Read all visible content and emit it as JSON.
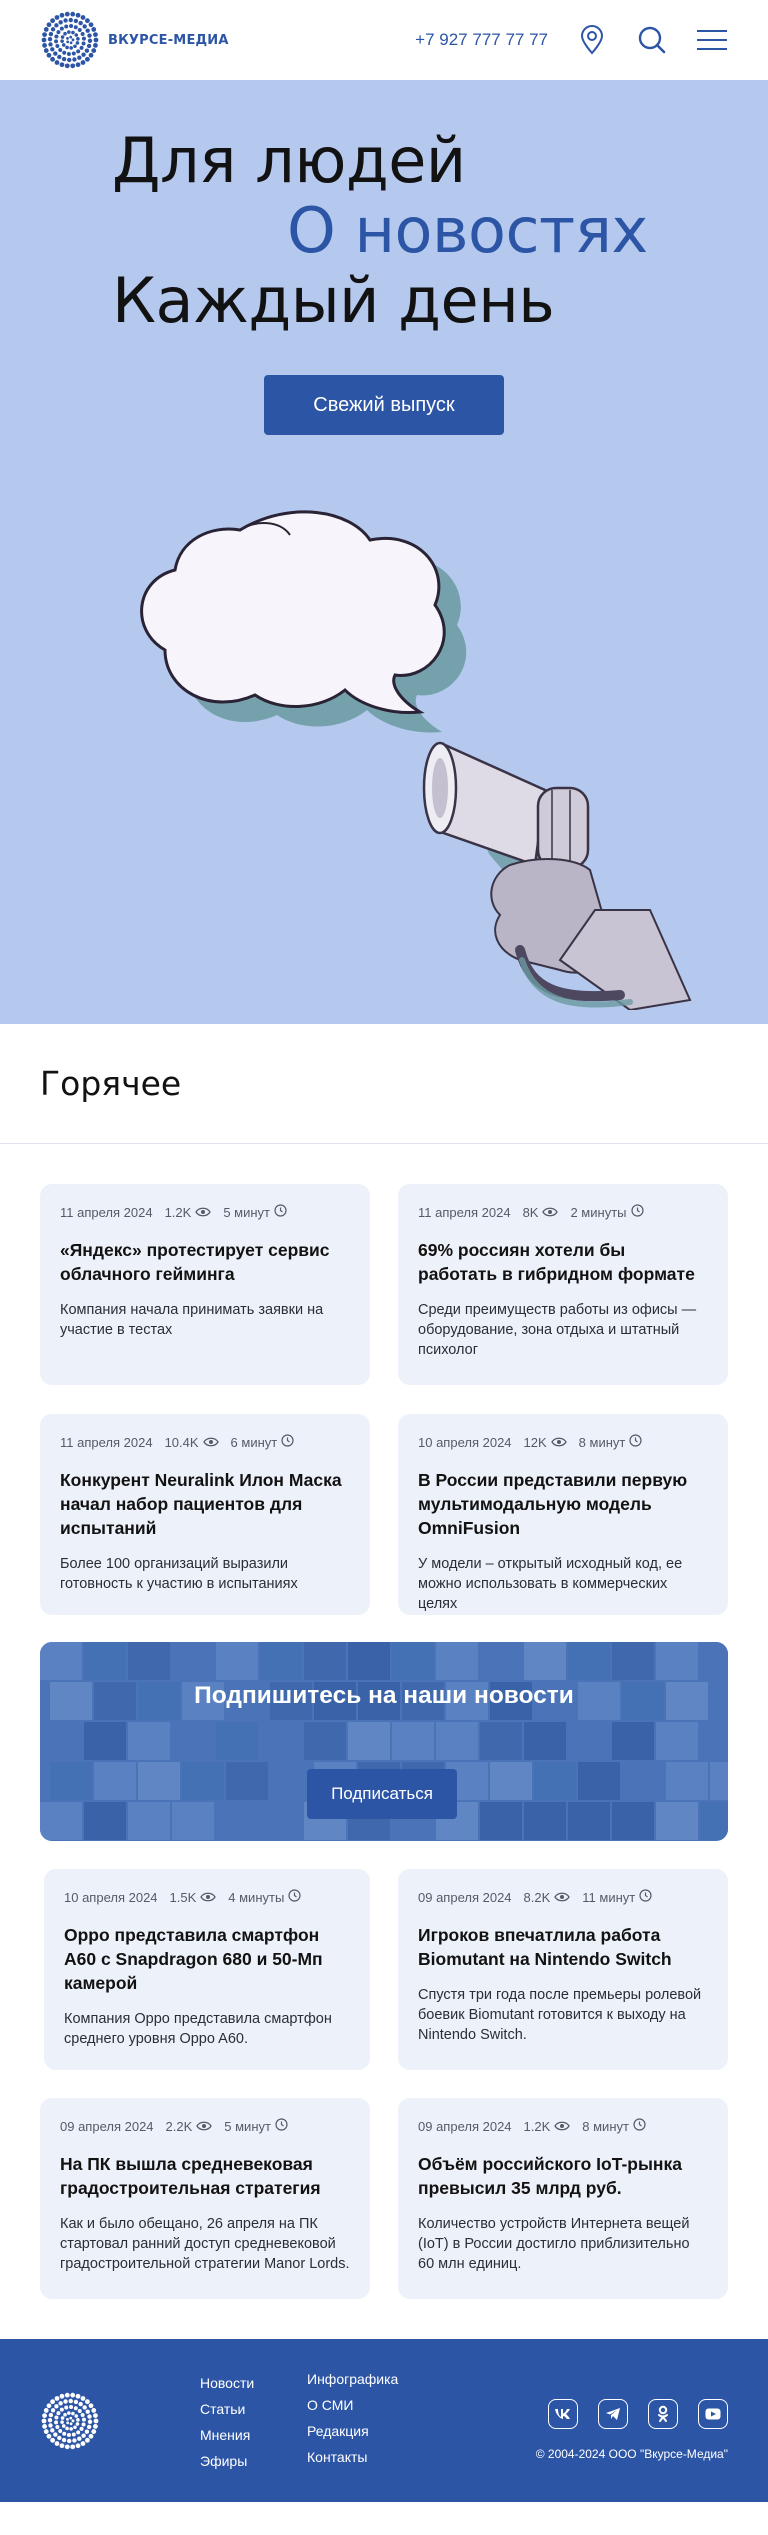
{
  "header": {
    "logo_text": "ВКУРСЕ-МЕДИА",
    "phone": "+7 927 777 77 77",
    "icons": [
      "location-pin-icon",
      "search-icon",
      "menu-icon"
    ]
  },
  "hero": {
    "line1": "Для людей",
    "line2": "О новостях",
    "line3": "Каждый день",
    "button": "Свежий выпуск"
  },
  "hot": {
    "title": "Горячее"
  },
  "cards_top": [
    {
      "date": "11 апреля 2024",
      "views": "1.2K",
      "read": "5 минут",
      "title": "«Яндекс» протестирует сервис облачного гейминга",
      "text": "Компания начала принимать заявки на участие в тестах"
    },
    {
      "date": "11 апреля 2024",
      "views": "8K",
      "read": "2 минуты",
      "title": "69% россиян хотели бы работать в гибридном формате",
      "text": "Среди преимуществ работы из офисы — оборудование, зона отдыха и штатный психолог"
    },
    {
      "date": "11 апреля 2024",
      "views": "10.4K",
      "read": "6 минут",
      "title": "Конкурент Neuralink Илон Маска начал набор пациентов для испытаний",
      "text": "Более 100 организаций выразили готовность к участию в испытаниях"
    },
    {
      "date": "10 апреля 2024",
      "views": "12K",
      "read": "8 минут",
      "title": "В России представили первую мультимодальную модель OmniFusion",
      "text": "У модели – открытый исходный код, ее можно использовать в коммерческих целях"
    }
  ],
  "subscribe": {
    "title": "Подпишитесь на наши новости",
    "button": "Подписаться"
  },
  "cards_bottom": [
    {
      "date": "10 апреля 2024",
      "views": "1.5K",
      "read": "4 минуты",
      "title": "Oppo представила смартфон A60 с Snapdragon 680 и 50-Мп камерой",
      "text": "Компания Oppo представила смартфон среднего уровня Oppo A60."
    },
    {
      "date": "09 апреля 2024",
      "views": "8.2K",
      "read": "11 минут",
      "title": "Игроков впечатлила работа Biomutant на Nintendo Switch",
      "text": "Спустя три года после премьеры ролевой боевик Biomutant готовится к выходу на Nintendo Switch."
    },
    {
      "date": "09 апреля 2024",
      "views": "2.2K",
      "read": "5 минут",
      "title": "На ПК вышла средневековая градостроительная стратегия",
      "text": "Как и было обещано, 26 апреля на ПК стартовал ранний доступ средневековой градостроительной стратегии Manor Lords."
    },
    {
      "date": "09 апреля 2024",
      "views": "1.2K",
      "read": "8 минут",
      "title": "Объём российского IoT-рынка превысил 35 млрд руб.",
      "text": "Количество устройств Интернета вещей (IoT) в России достигло приблизительно 60 млн единиц."
    }
  ],
  "footer": {
    "col1": [
      "Новости",
      "Статьи",
      "Мнения",
      "Эфиры"
    ],
    "col2": [
      "Инфографика",
      "О СМИ",
      "Редакция",
      "Контакты"
    ],
    "socials": [
      "vk-icon",
      "telegram-icon",
      "odnoklassniki-icon",
      "youtube-icon"
    ],
    "copyright": "© 2004-2024 ООО \"Вкурсе-Медиа\""
  },
  "colors": {
    "brand": "#2d55a6",
    "hero_bg": "#b5c9ef",
    "card_bg": "#edf1f9"
  }
}
